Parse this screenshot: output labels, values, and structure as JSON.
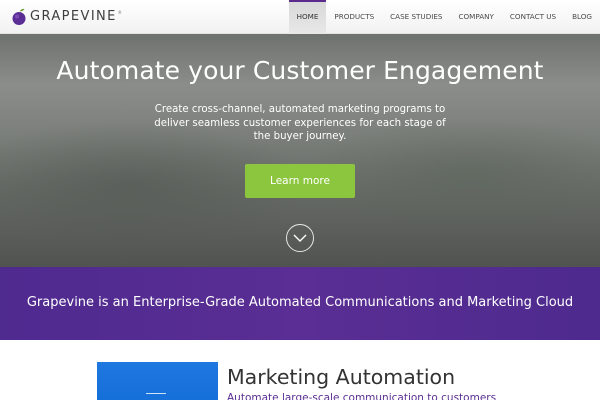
{
  "header": {
    "logo_text": "GRAPEVINE",
    "logo_tm": "®",
    "logo_icon": "grape-icon",
    "nav": [
      {
        "label": "HOME",
        "active": true
      },
      {
        "label": "PRODUCTS",
        "active": false
      },
      {
        "label": "CASE STUDIES",
        "active": false
      },
      {
        "label": "COMPANY",
        "active": false
      },
      {
        "label": "CONTACT US",
        "active": false
      },
      {
        "label": "BLOG",
        "active": false
      }
    ]
  },
  "hero": {
    "title": "Automate your Customer Engagement",
    "subtitle": "Create cross-channel, automated marketing programs to deliver seamless customer experiences for each stage of the buyer journey.",
    "cta_label": "Learn more",
    "scroll_icon": "chevron-down-circle-icon"
  },
  "band": {
    "text": "Grapevine is an Enterprise-Grade Automated Communications and Marketing Cloud"
  },
  "feature": {
    "title": "Marketing Automation",
    "subtitle": "Automate large-scale communication to customers"
  },
  "colors": {
    "brand_purple": "#5a2e94",
    "cta_green": "#8cc63f",
    "feature_blue": "#1f78e0"
  }
}
